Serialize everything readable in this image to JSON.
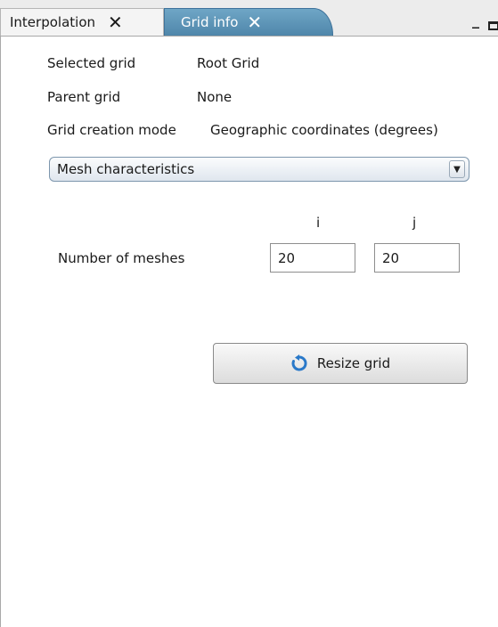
{
  "tabs": [
    {
      "label": "Interpolation",
      "close": "✕",
      "active": false
    },
    {
      "label": "Grid info",
      "close": "✕",
      "active": true
    }
  ],
  "window_controls": {
    "minimize_icon": "minimize-icon",
    "maximize_icon": "maximize-icon"
  },
  "info": [
    {
      "label": "Selected grid",
      "value": "Root Grid"
    },
    {
      "label": "Parent grid",
      "value": "None"
    },
    {
      "label": "Grid creation mode",
      "value": "Geographic coordinates (degrees)"
    }
  ],
  "dropdown": {
    "selected": "Mesh characteristics",
    "icon": "chevron-down-icon"
  },
  "meshes": {
    "col_i": "i",
    "col_j": "j",
    "label": "Number of meshes",
    "i_value": "20",
    "j_value": "20"
  },
  "resize_button": {
    "label": "Resize grid",
    "icon": "refresh-icon"
  },
  "colors": {
    "active_tab": "#4f86aa",
    "refresh_icon": "#2a79c9"
  }
}
